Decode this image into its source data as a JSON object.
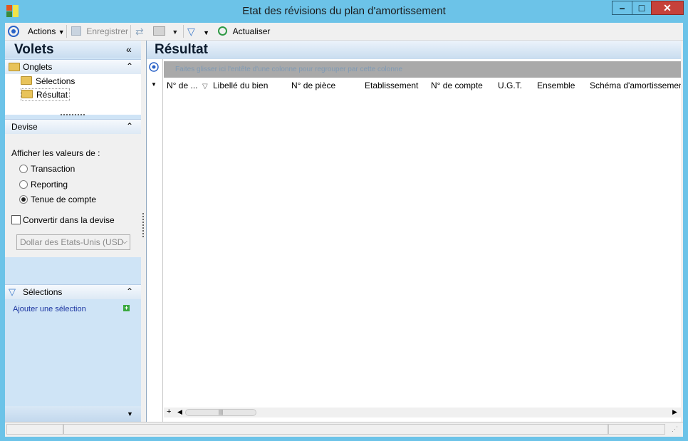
{
  "window": {
    "title": "Etat des révisions du plan d'amortissement"
  },
  "toolbar": {
    "actions_label": "Actions",
    "save_label": "Enregistrer",
    "refresh_label": "Actualiser"
  },
  "sidebar": {
    "title": "Volets",
    "onglets": {
      "title": "Onglets",
      "items": [
        {
          "label": "Sélections"
        },
        {
          "label": "Résultat"
        }
      ]
    },
    "devise": {
      "title": "Devise",
      "show_values_label": "Afficher les valeurs de :",
      "options": [
        {
          "label": "Transaction",
          "selected": false
        },
        {
          "label": "Reporting",
          "selected": false
        },
        {
          "label": "Tenue de compte",
          "selected": true
        }
      ],
      "convert_label": "Convertir dans la devise",
      "currency_value": "Dollar des Etats-Unis (USD"
    },
    "selections": {
      "title": "Sélections",
      "add_label": "Ajouter une sélection"
    }
  },
  "main": {
    "title": "Résultat",
    "group_hint": "Faites glisser ici l'entête d'une colonne pour regrouper par cette colonne",
    "columns": [
      "N° de ...",
      "Libellé du bien",
      "N° de pièce",
      "Etablissement",
      "N° de compte",
      "U.G.T.",
      "Ensemble",
      "Schéma d'amortissement"
    ]
  },
  "colors": {
    "titlebar": "#6cc3e8",
    "accent": "#1a33a0",
    "close": "#c6413a"
  }
}
